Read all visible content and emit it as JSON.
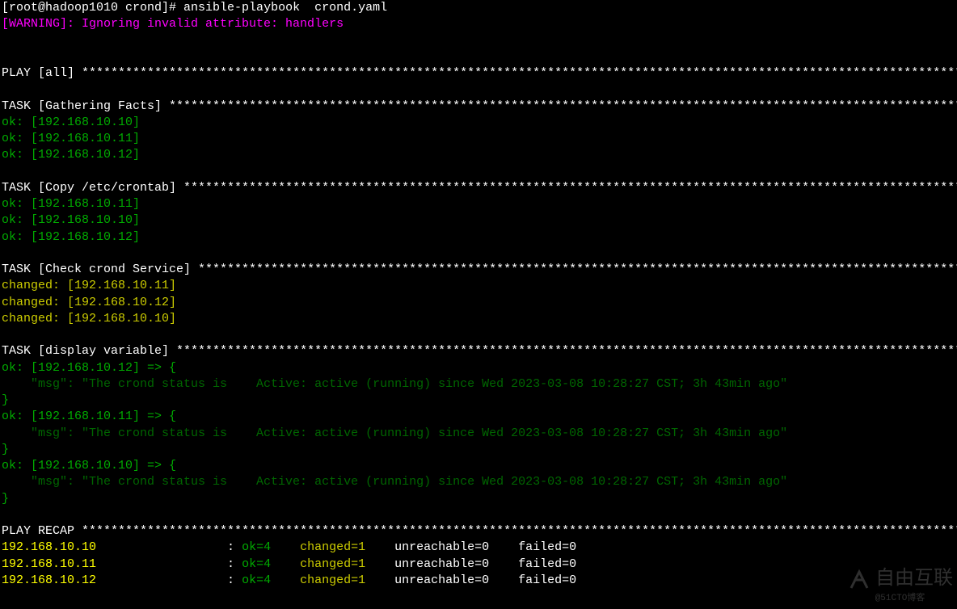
{
  "prompt": {
    "prefix": "[root@hadoop1010 crond]# ",
    "command": "ansible-playbook  crond.yaml"
  },
  "warning": "[WARNING]: Ignoring invalid attribute: handlers",
  "play_header": "PLAY [all] ",
  "tasks": {
    "gathering": {
      "header": "TASK [Gathering Facts] ",
      "results": [
        "ok: [192.168.10.10]",
        "ok: [192.168.10.11]",
        "ok: [192.168.10.12]"
      ]
    },
    "copy": {
      "header": "TASK [Copy /etc/crontab] ",
      "results": [
        "ok: [192.168.10.11]",
        "ok: [192.168.10.10]",
        "ok: [192.168.10.12]"
      ]
    },
    "check": {
      "header": "TASK [Check crond Service] ",
      "results": [
        "changed: [192.168.10.11]",
        "changed: [192.168.10.12]",
        "changed: [192.168.10.10]"
      ]
    },
    "display": {
      "header": "TASK [display variable] ",
      "blocks": [
        {
          "open": "ok: [192.168.10.12] => {",
          "msg": "    \"msg\": \"The crond status is    Active: active (running) since Wed 2023-03-08 10:28:27 CST; 3h 43min ago\"",
          "close": "}"
        },
        {
          "open": "ok: [192.168.10.11] => {",
          "msg": "    \"msg\": \"The crond status is    Active: active (running) since Wed 2023-03-08 10:28:27 CST; 3h 43min ago\"",
          "close": "}"
        },
        {
          "open": "ok: [192.168.10.10] => {",
          "msg": "    \"msg\": \"The crond status is    Active: active (running) since Wed 2023-03-08 10:28:27 CST; 3h 43min ago\"",
          "close": "}"
        }
      ]
    }
  },
  "recap": {
    "header": "PLAY RECAP ",
    "hosts": [
      {
        "host": "192.168.10.10",
        "ok": "ok=4",
        "changed": "changed=1",
        "unreachable": "unreachable=0",
        "failed": "failed=0"
      },
      {
        "host": "192.168.10.11",
        "ok": "ok=4",
        "changed": "changed=1",
        "unreachable": "unreachable=0",
        "failed": "failed=0"
      },
      {
        "host": "192.168.10.12",
        "ok": "ok=4",
        "changed": "changed=1",
        "unreachable": "unreachable=0",
        "failed": "failed=0"
      }
    ]
  },
  "watermark": {
    "text": "自由互联",
    "sub": "@51CTO博客"
  }
}
